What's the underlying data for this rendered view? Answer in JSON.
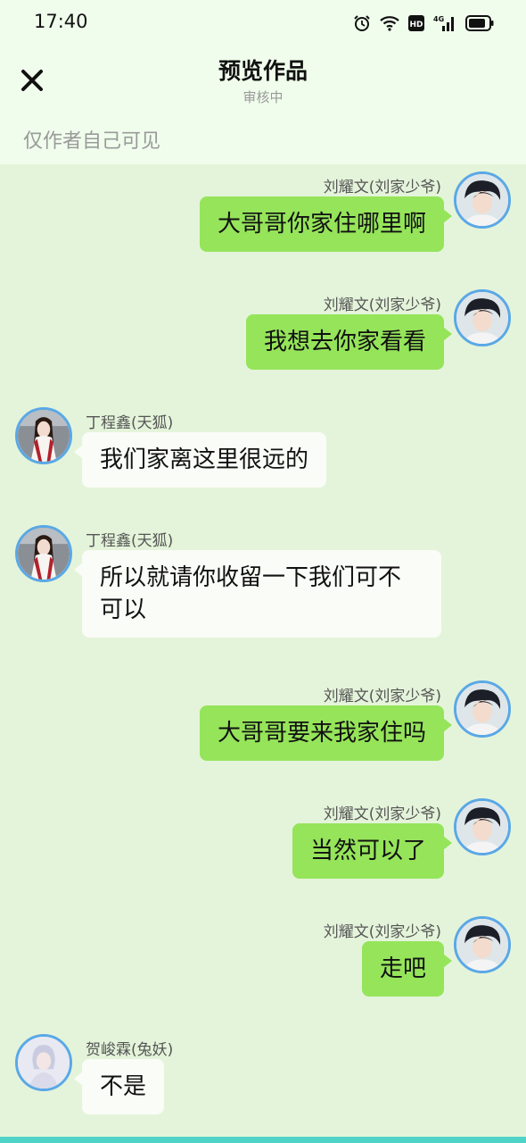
{
  "status_bar": {
    "time": "17:40",
    "icons": [
      "alarm-icon",
      "wifi-icon",
      "hd-icon",
      "signal-4g-icon",
      "battery-icon"
    ],
    "hd_label": "HD",
    "network_label": "4G"
  },
  "nav": {
    "close_icon": "close-icon",
    "title": "预览作品",
    "subtitle": "审核中"
  },
  "visibility_note": "仅作者自己可见",
  "colors": {
    "background": "#e4f4da",
    "header_background": "#f0fdec",
    "own_bubble": "#95e45a",
    "other_bubble": "#fafcf7",
    "avatar_border": "#5aa8e6"
  },
  "messages": [
    {
      "side": "right",
      "sender": "刘耀文(刘家少爷)",
      "text": "大哥哥你家住哪里啊"
    },
    {
      "side": "right",
      "sender": "刘耀文(刘家少爷)",
      "text": "我想去你家看看"
    },
    {
      "side": "left",
      "sender": "丁程鑫(天狐)",
      "text": "我们家离这里很远的"
    },
    {
      "side": "left",
      "sender": "丁程鑫(天狐)",
      "text": "所以就请你收留一下我们可不可以"
    },
    {
      "side": "right",
      "sender": "刘耀文(刘家少爷)",
      "text": "大哥哥要来我家住吗"
    },
    {
      "side": "right",
      "sender": "刘耀文(刘家少爷)",
      "text": "当然可以了"
    },
    {
      "side": "right",
      "sender": "刘耀文(刘家少爷)",
      "text": "走吧"
    },
    {
      "side": "left",
      "sender": "贺峻霖(兔妖)",
      "text": "不是"
    }
  ]
}
